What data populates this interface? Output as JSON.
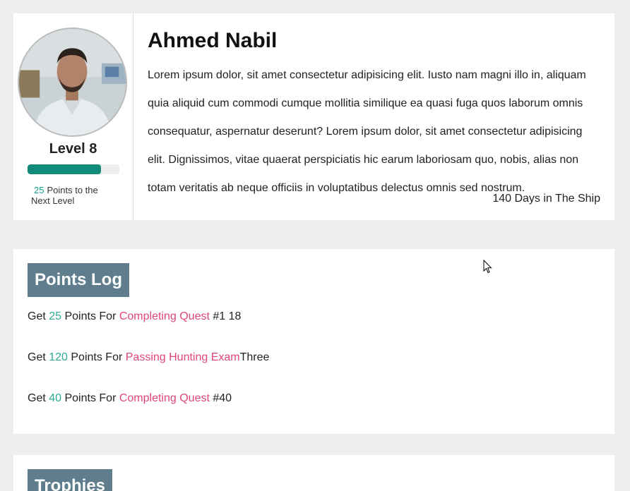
{
  "profile": {
    "name": "Ahmed Nabil",
    "level_label": "Level 8",
    "progress_fraction": 0.8,
    "points_to_next": "25",
    "points_to_next_text": "Points to the Next Level",
    "bio": "Lorem ipsum dolor, sit amet consectetur adipisicing elit. Iusto nam magni illo in, aliquam quia aliquid cum commodi cumque mollitia similique ea quasi fuga quos laborum omnis consequatur, aspernatur deserunt? Lorem ipsum dolor, sit amet consectetur adipisicing elit. Dignissimos, vitae quaerat perspiciatis hic earum laboriosam quo, nobis, alias non totam veritatis ab neque officiis in voluptatibus delectus omnis sed nostrum.",
    "days_text": "140 Days in The Ship"
  },
  "points_log": {
    "title": "Points Log",
    "items": [
      {
        "prefix": "Get ",
        "points": "25",
        "mid": " Points For ",
        "action": "Completing Quest",
        "suffix": " #1 18"
      },
      {
        "prefix": "Get ",
        "points": "120",
        "mid": " Points For ",
        "action": "Passing Hunting Exam",
        "suffix": "Three"
      },
      {
        "prefix": "Get ",
        "points": "40",
        "mid": " Points For ",
        "action": "Completing Quest",
        "suffix": " #40"
      }
    ]
  },
  "trophies": {
    "title": "Trophies"
  },
  "colors": {
    "accent_green": "#128a78",
    "points_teal": "#2eaa98",
    "action_pink": "#e0457a",
    "section_header": "#5f7d8c"
  }
}
